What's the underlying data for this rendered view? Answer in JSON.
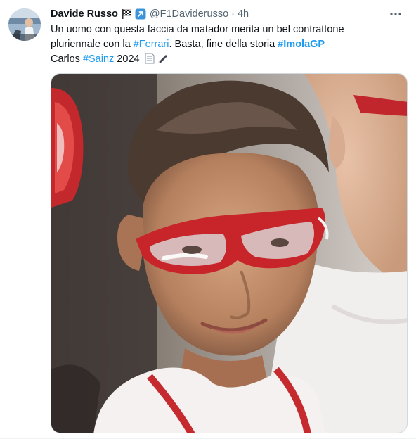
{
  "author": {
    "display_name": "Davide Russo",
    "handle": "@F1Daviderusso",
    "time": "4h",
    "badges": [
      "chequered-flag-icon",
      "arrow-up-right-icon"
    ]
  },
  "tweet": {
    "line1": "Un uomo con questa faccia da matador merita un bel contrattone",
    "line2_prefix": "pluriennale con la ",
    "hashtag_ferrari": "#Ferrari",
    "line2_middle": ". Basta, fine della storia ",
    "hashtag_imola": "#ImolaGP",
    "line3_prefix": "Carlos ",
    "hashtag_sainz": "#Sainz",
    "line3_suffix": " 2024",
    "trailing_icons": [
      "document-icon",
      "pen-icon"
    ]
  },
  "colors": {
    "link": "#1d9bf0",
    "text": "#0f1419",
    "secondary": "#536471",
    "border": "#cfd9de"
  }
}
